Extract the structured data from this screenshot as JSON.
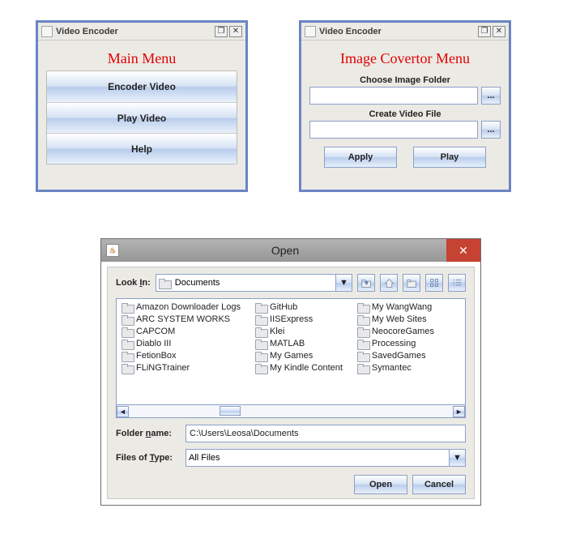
{
  "window1": {
    "title": "Video Encoder",
    "heading": "Main Menu",
    "buttons": [
      "Encoder Video",
      "Play Video",
      "Help"
    ]
  },
  "window2": {
    "title": "Video Encoder",
    "heading": "Image Covertor Menu",
    "choose_label": "Choose Image Folder",
    "create_label": "Create Video File",
    "choose_value": "",
    "create_value": "",
    "apply": "Apply",
    "play": "Play",
    "browse": "..."
  },
  "dialog": {
    "title": "Open",
    "lookin_label": "Look In:",
    "lookin_value": "Documents",
    "folder_name_label": "Folder name:",
    "folder_name_value": "C:\\Users\\Leosa\\Documents",
    "files_type_label": "Files of Type:",
    "files_type_value": "All Files",
    "open": "Open",
    "cancel": "Cancel",
    "columns": [
      [
        "Amazon Downloader Logs",
        "ARC SYSTEM WORKS",
        "CAPCOM",
        "Diablo III",
        "FetionBox",
        "FLiNGTrainer"
      ],
      [
        "GitHub",
        "IISExpress",
        "Klei",
        "MATLAB",
        "My Games",
        "My Kindle Content"
      ],
      [
        "My WangWang",
        "My Web Sites",
        "NeocoreGames",
        "Processing",
        "SavedGames",
        "Symantec"
      ]
    ]
  }
}
